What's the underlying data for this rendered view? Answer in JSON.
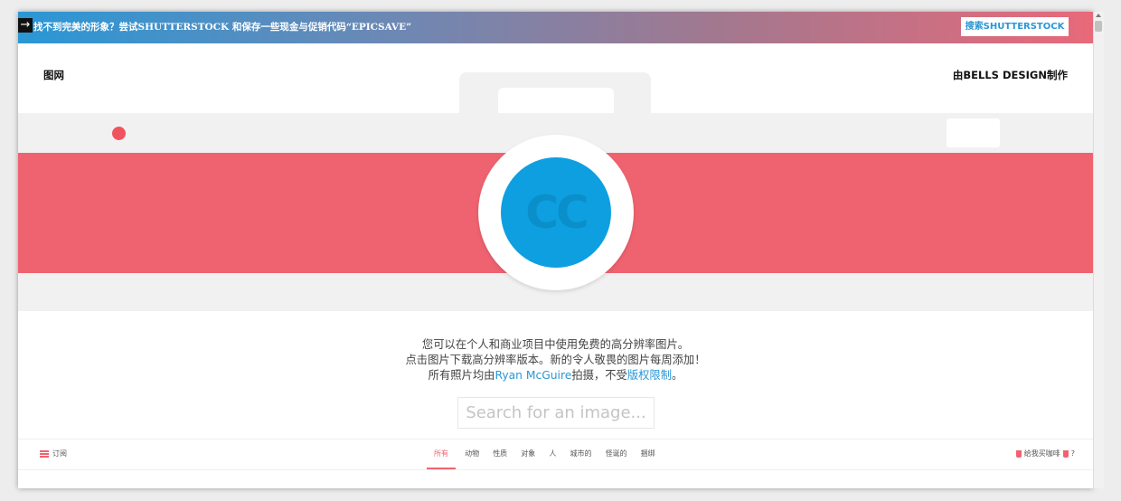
{
  "promo": {
    "arrow": "→",
    "text": "找不到完美的形象？尝试SHUTTERSTOCK 和保存一些现金与促销代码“EPICSAVE”",
    "button_label": "搜索SHUTTERSTOCK"
  },
  "header": {
    "logo": "图网",
    "credit": "由BELLS DESIGN制作"
  },
  "hero": {
    "lens_text": "CC"
  },
  "description": {
    "line1": "您可以在个人和商业项目中使用免费的高分辨率图片。",
    "line2": "点击图片下载高分辨率版本。新的令人敬畏的图片每周添加！",
    "line3_prefix": "所有照片均由",
    "line3_author": "Ryan McGuire",
    "line3_middle": "拍摄，不受",
    "line3_link": "版权限制",
    "line3_suffix": "。"
  },
  "search": {
    "placeholder": "Search for an image..."
  },
  "nav": {
    "subscribe_label": "订阅",
    "categories": [
      "所有",
      "动物",
      "性质",
      "对象",
      "人",
      "城市的",
      "怪诞的",
      "捆绑"
    ],
    "coffee_label": "给我买咖啡",
    "coffee_suffix": "?"
  },
  "colors": {
    "accent": "#ef6370",
    "link": "#2a97d6",
    "lens": "#0e9fe0"
  }
}
